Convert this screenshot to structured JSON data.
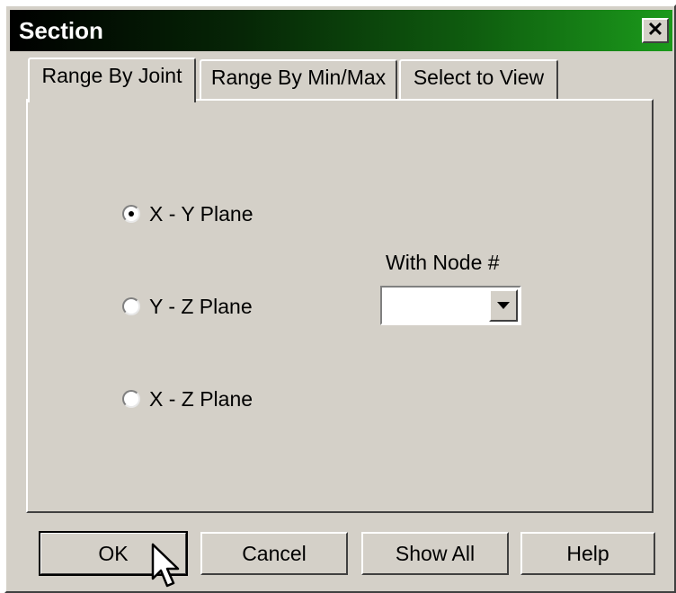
{
  "window": {
    "title": "Section",
    "close_label": "✕"
  },
  "tabs": [
    {
      "label": "Range By Joint",
      "active": true
    },
    {
      "label": "Range By Min/Max",
      "active": false
    },
    {
      "label": "Select to View",
      "active": false
    }
  ],
  "planes": [
    {
      "label": "X - Y Plane",
      "checked": true
    },
    {
      "label": "Y - Z Plane",
      "checked": false
    },
    {
      "label": "X - Z Plane",
      "checked": false
    }
  ],
  "node": {
    "label": "With Node #",
    "value": ""
  },
  "buttons": {
    "ok": "OK",
    "cancel": "Cancel",
    "show_all": "Show All",
    "help": "Help"
  },
  "colors": {
    "face": "#d4d0c8",
    "titlebar_start": "#000000",
    "titlebar_end": "#1b9a1b"
  },
  "icons": {
    "close": "close-icon",
    "dropdown": "chevron-down-icon",
    "cursor": "mouse-pointer-icon"
  }
}
